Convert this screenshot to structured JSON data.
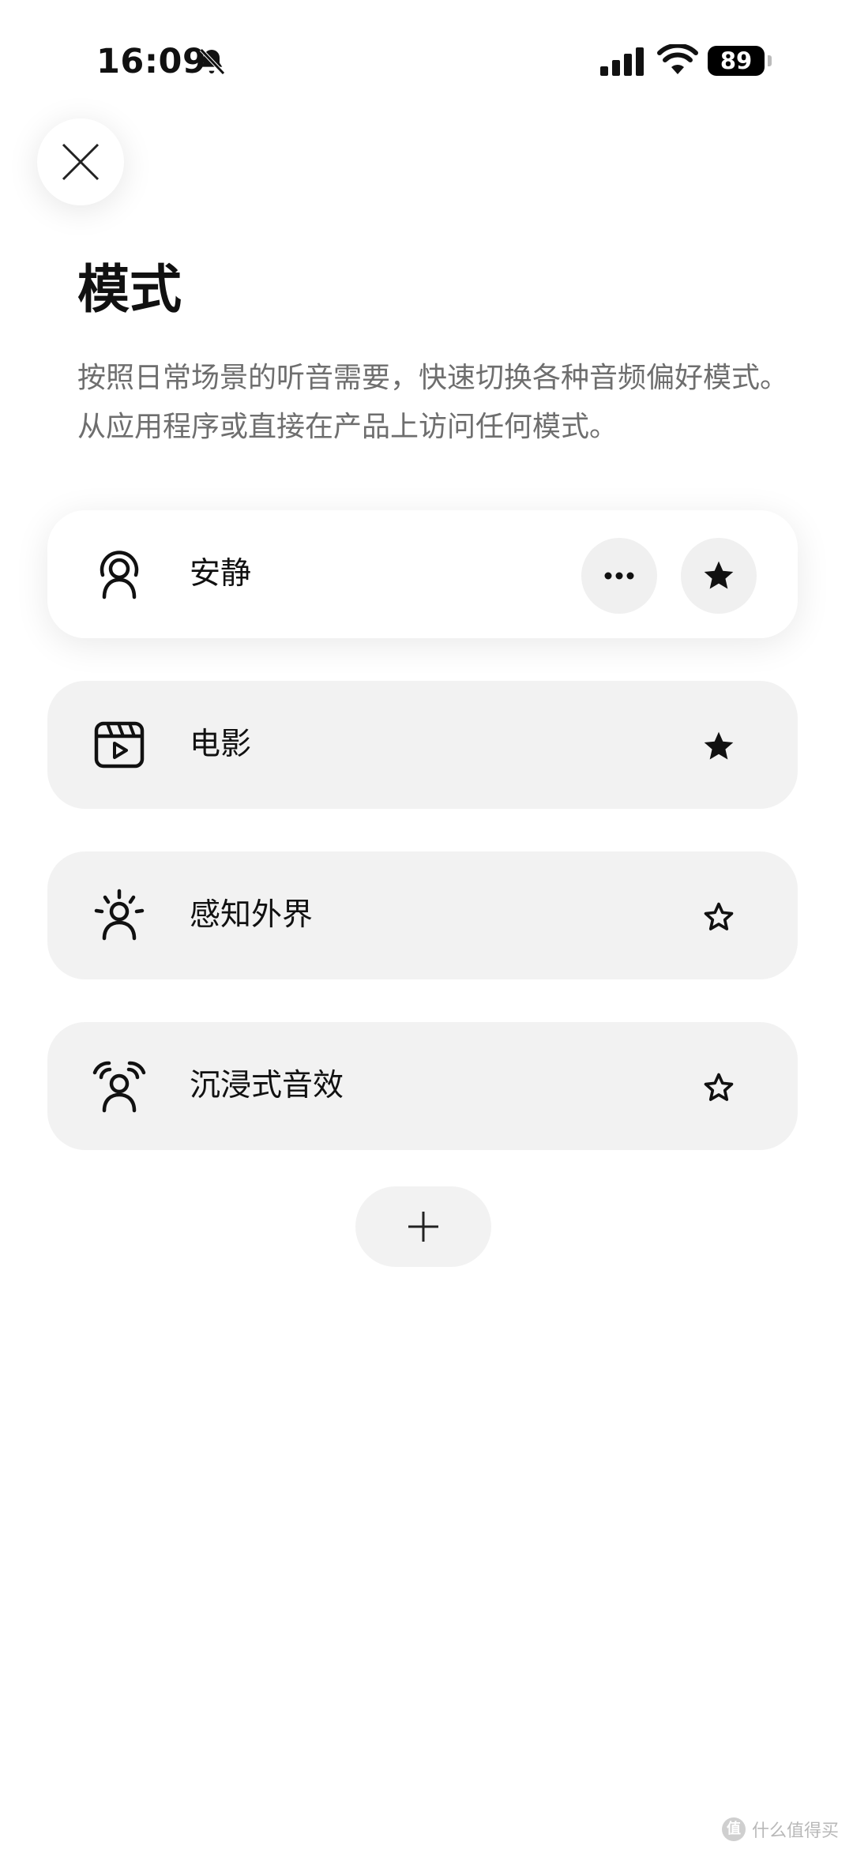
{
  "status_bar": {
    "time": "16:09",
    "battery": "89",
    "icons": [
      "bell-muted-icon",
      "cellular-signal-icon",
      "wifi-icon",
      "battery-icon"
    ]
  },
  "header": {
    "close_icon": "close-icon",
    "title": "模式",
    "description": "按照日常场景的听音需要，快速切换各种音频偏好模式。从应用程序或直接在产品上访问任何模式。"
  },
  "modes": [
    {
      "label": "安静",
      "icon": "quiet-person-icon",
      "active": true,
      "favorite": true,
      "has_more": true
    },
    {
      "label": "电影",
      "icon": "movie-clapper-icon",
      "active": false,
      "favorite": true,
      "has_more": false
    },
    {
      "label": "感知外界",
      "icon": "aware-person-icon",
      "active": false,
      "favorite": false,
      "has_more": false
    },
    {
      "label": "沉浸式音效",
      "icon": "immersive-person-icon",
      "active": false,
      "favorite": false,
      "has_more": false
    }
  ],
  "add_button": {
    "icon": "plus-icon"
  },
  "watermark": {
    "text": "什么值得买",
    "logo": "值"
  },
  "colors": {
    "card_bg": "#f2f2f2",
    "active_card_bg": "#ffffff",
    "text": "#111111",
    "secondary_text": "#6e6e6e"
  }
}
